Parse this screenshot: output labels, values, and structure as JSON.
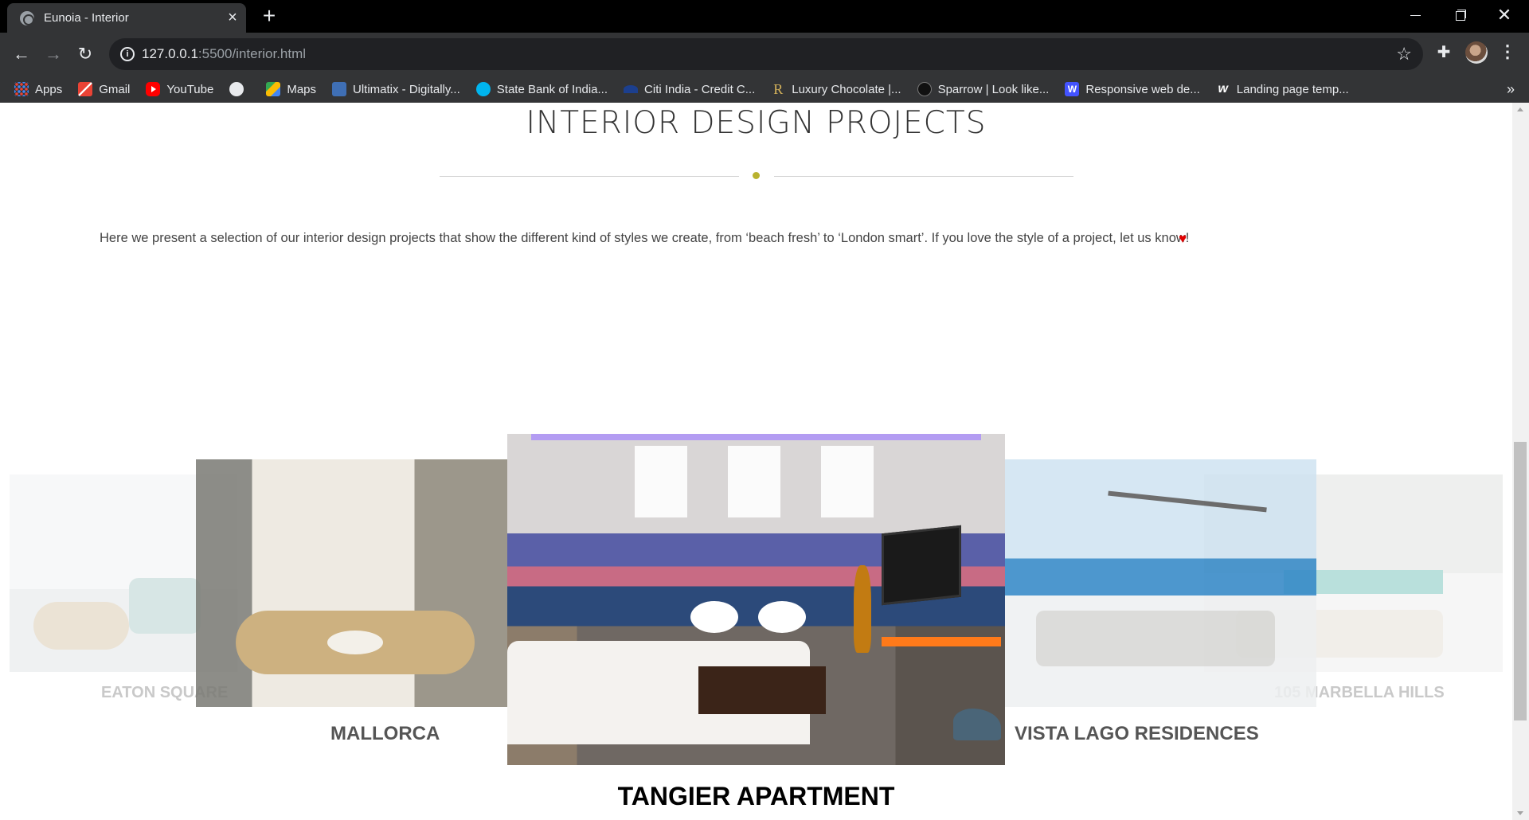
{
  "browser": {
    "tab_title": "Eunoia - Interior",
    "url_host": "127.0.0.1",
    "url_rest": ":5500/interior.html",
    "bookmarks": [
      {
        "label": "Apps",
        "icon": "apps-grid-icon"
      },
      {
        "label": "Gmail",
        "icon": "gmail-icon"
      },
      {
        "label": "YouTube",
        "icon": "youtube-icon"
      },
      {
        "label": "",
        "icon": "globe-icon"
      },
      {
        "label": "Maps",
        "icon": "maps-icon"
      },
      {
        "label": "Ultimatix - Digitally...",
        "icon": "tata-icon"
      },
      {
        "label": "State Bank of India...",
        "icon": "sbi-icon"
      },
      {
        "label": "Citi India - Credit C...",
        "icon": "citi-icon"
      },
      {
        "label": "Luxury Chocolate |...",
        "icon": "r-icon"
      },
      {
        "label": "Sparrow | Look like...",
        "icon": "sparrow-icon"
      },
      {
        "label": "Responsive web de...",
        "icon": "webflow-icon"
      },
      {
        "label": "Landing page temp...",
        "icon": "w-icon"
      }
    ],
    "more_bookmarks": "»"
  },
  "section": {
    "title": "INTERIOR DESIGN PROJECTS",
    "intro": "Here we present a selection of our interior design projects that show the different kind of styles we create, from ‘beach fresh’ to ‘London smart’. If you love the style of a project, let us know!",
    "accent_color": "#b9b22f",
    "heart_color": "#e00000"
  },
  "carousel": {
    "projects": [
      {
        "name": "EATON SQUARE",
        "position": "far-left"
      },
      {
        "name": "MALLORCA",
        "position": "left"
      },
      {
        "name": "TANGIER APARTMENT",
        "position": "center"
      },
      {
        "name": "VISTA LAGO RESIDENCES",
        "position": "right"
      },
      {
        "name": "105 MARBELLA HILLS",
        "position": "far-right"
      }
    ]
  }
}
